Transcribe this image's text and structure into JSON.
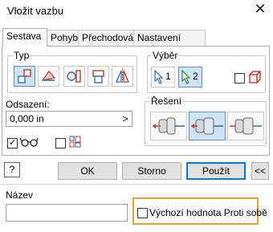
{
  "window": {
    "title": "Vložit vazbu",
    "close_label": "✕"
  },
  "tabs": [
    {
      "label": "Sestava",
      "active": true
    },
    {
      "label": "Pohyb",
      "active": false
    },
    {
      "label": "Přechodová",
      "active": false
    },
    {
      "label": "Nastavení vazby",
      "active": false
    }
  ],
  "type_group": {
    "label": "Typ",
    "selected_index": 0
  },
  "selection_group": {
    "label": "Výběr",
    "pick1_label": "1",
    "pick2_label": "2",
    "highlight_checked": false
  },
  "offset": {
    "label": "Odsazení:",
    "value": "0,000 in",
    "arrow": ">"
  },
  "solution_group": {
    "label": "Řešení",
    "selected_index": 1
  },
  "options": {
    "glasses_checked": true,
    "show_preview_checked": false
  },
  "buttons": {
    "help": "?",
    "ok": "OK",
    "cancel": "Storno",
    "apply": "Použít",
    "collapse": "<<"
  },
  "name_section": {
    "label": "Název",
    "value": "",
    "default_opposite_label": "Výchozí hodnota Proti sobě",
    "default_opposite_checked": false
  },
  "colors": {
    "accent_blue": "#0078d7",
    "highlight_orange": "#f0a030",
    "select_bg": "#cfe3f7"
  }
}
